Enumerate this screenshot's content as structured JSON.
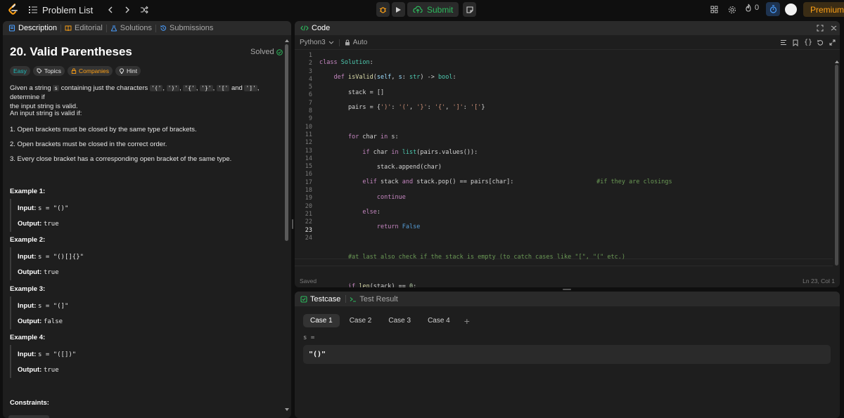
{
  "navbar": {
    "title": "Problem List",
    "submit_label": "Submit",
    "streak_count": "0",
    "premium_label": "Premium",
    "icons": [
      "leetcode-logo",
      "list-icon",
      "chevron-left-icon",
      "chevron-right-icon",
      "shuffle-icon",
      "debug-icon",
      "play-icon",
      "cloud-upload-icon",
      "note-icon",
      "layout-icon",
      "gear-icon",
      "flame-icon",
      "timer-icon",
      "avatar"
    ]
  },
  "left_tabs": [
    {
      "label": "Description",
      "active": true
    },
    {
      "label": "Editorial",
      "active": false
    },
    {
      "label": "Solutions",
      "active": false
    },
    {
      "label": "Submissions",
      "active": false
    }
  ],
  "problem": {
    "title": "20. Valid Parentheses",
    "status": "Solved",
    "tags": [
      "Easy",
      "Topics",
      "Companies",
      "Hint"
    ],
    "desc_pre": "Given a string ",
    "desc_s": "s",
    "desc_mid": " containing just the characters ",
    "chars": [
      "'('",
      "')'",
      "'{'",
      "'}'",
      "'['",
      "']'"
    ],
    "desc_and": "and",
    "desc_post": ", determine if",
    "desc_line2": "the input string is valid.",
    "valid_intro": "An input string is valid if:",
    "rules": [
      "1. Open brackets must be closed by the same type of brackets.",
      "2. Open brackets must be closed in the correct order.",
      "3. Every close bracket has a corresponding open bracket of the same type."
    ],
    "input_label": "Input:",
    "output_label": "Output:",
    "examples": [
      {
        "heading": "Example 1:",
        "input": "s = \"()\"",
        "output": "true"
      },
      {
        "heading": "Example 2:",
        "input": "s = \"()[]{}\"",
        "output": "true"
      },
      {
        "heading": "Example 3:",
        "input": "s = \"(]\"",
        "output": "false"
      },
      {
        "heading": "Example 4:",
        "input": "s = \"([])\"",
        "output": "true"
      }
    ],
    "constraints_heading": "Constraints:"
  },
  "code_panel": {
    "title": "Code",
    "language": "Python3",
    "mode": "Auto",
    "status": "Saved",
    "cursor": "Ln 23, Col 1",
    "line_numbers": [
      "1",
      "2",
      "3",
      "4",
      "5",
      "6",
      "7",
      "8",
      "9",
      "10",
      "11",
      "12",
      "13",
      "14",
      "15",
      "16",
      "17",
      "18",
      "19",
      "20",
      "21",
      "22",
      "23",
      "24"
    ]
  },
  "test_panel": {
    "tab_testcase": "Testcase",
    "tab_result": "Test Result",
    "cases": [
      "Case 1",
      "Case 2",
      "Case 3",
      "Case 4"
    ],
    "add_label": "+",
    "var_name": "s =",
    "var_value": "\"()\""
  },
  "colors": {
    "accent": "#ffa116",
    "success": "#2cbb5d",
    "easy": "#1cbaba",
    "panel": "#1e1e1e",
    "background": "#0f0f0f"
  }
}
